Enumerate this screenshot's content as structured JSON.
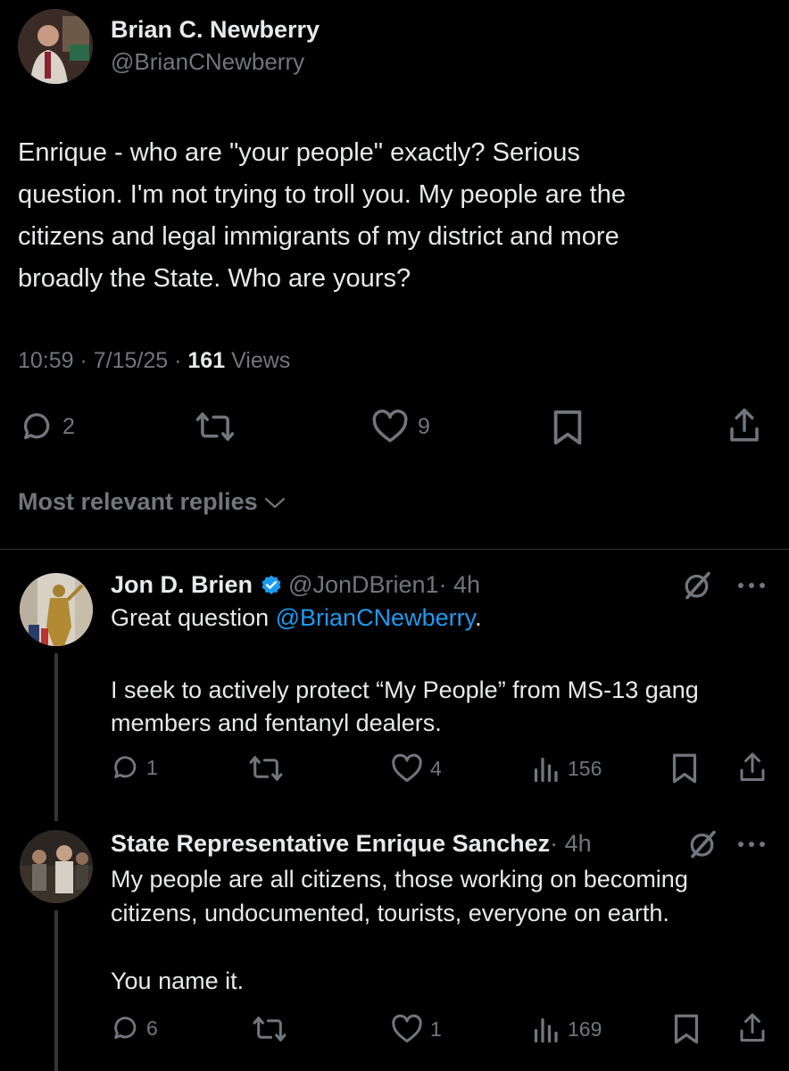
{
  "main_tweet": {
    "author_name": "Brian C. Newberry",
    "author_handle": "@BrianCNewberry",
    "text": "Enrique - who are \"your people\" exactly? Serious\nquestion.  I'm not trying to troll you. My people are the\ncitizens and legal immigrants of my district and more\nbroadly the State.  Who are yours?",
    "time": "10:59 · 7/15/25 · ",
    "views_count": "161",
    "views_label": " Views",
    "replies": "2",
    "likes": "9",
    "icons": [
      "reply-icon",
      "retweet-icon",
      "like-icon",
      "bookmark-icon",
      "share-icon"
    ]
  },
  "replies_filter": {
    "label": "Most relevant replies",
    "icon": "chevron-down-icon"
  },
  "replies": [
    {
      "author_name": "Jon D. Brien",
      "verified": true,
      "author_handle": "@JonDBrien1",
      "time": " · 4h",
      "text_before_mention": "Great question ",
      "mention": "@BrianCNewberry",
      "text_after_mention": ".",
      "body": "I seek to actively protect “My People” from MS-13 gang\nmembers and fentanyl dealers.",
      "replies": "1",
      "likes": "4",
      "views": "156"
    },
    {
      "author_name": "State Representative Enrique Sanchez",
      "time": " · 4h",
      "body": "My people are all citizens, those working on becoming\ncitizens, undocumented, tourists, everyone on earth.\n\nYou name it.",
      "replies": "6",
      "likes": "1",
      "views": "169"
    }
  ],
  "colors": {
    "background": "#000000",
    "text": "#e7e9ea",
    "muted": "#71767b",
    "link": "#1d9bf0",
    "verified": "#1d9bf0",
    "divider": "#2f3336"
  }
}
